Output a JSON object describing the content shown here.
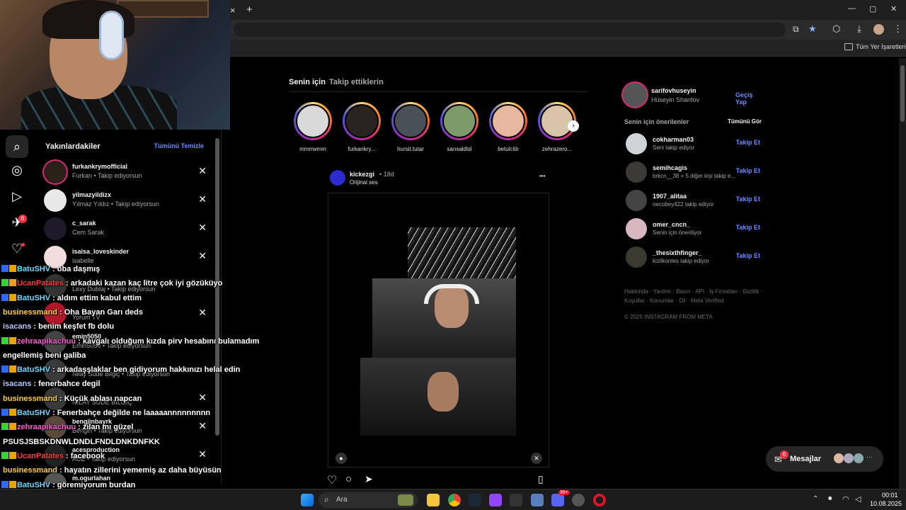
{
  "browser": {
    "new_tab": "+",
    "tab_close": "×",
    "window_controls": [
      "—",
      "▢",
      "✕"
    ],
    "bookmarks_label": "Tüm Yer İşaretleri"
  },
  "left_nav": {
    "notifications_badge": "6"
  },
  "recent_panel": {
    "title": "Yakınlardakiler",
    "clear_all": "Tümünü Temizle",
    "items": [
      {
        "username": "furkankrymofficial",
        "sub": "Furkan • Takip ediyorsun"
      },
      {
        "username": "yilmazyildizx",
        "sub": "Yılmaz Yıldız • Takip ediyorsun"
      },
      {
        "username": "c_sarak",
        "sub": "Cem Sarak"
      },
      {
        "username": "isaisa_loveskinder",
        "sub": "isabelle"
      },
      {
        "username": "",
        "sub": "Lexy Dublaj • Takip ediyorsun"
      },
      {
        "username": "",
        "sub": "Yorum TV"
      },
      {
        "username": "emin5050",
        "sub": "Emin5050 • Takip ediyorsun"
      },
      {
        "username": "",
        "sub": "Nilay Sude Bilgiç • Takip ediyorsun"
      },
      {
        "username": "",
        "sub": "NİLAY SUDE BİLGİÇ"
      },
      {
        "username": "bengiinbayrk",
        "sub": "Bengin • Takip ediyorsun"
      },
      {
        "username": "acesproduction",
        "sub": "ACE • Takip ediyorsun"
      },
      {
        "username": "m.ogurlahan",
        "sub": ""
      }
    ]
  },
  "chat": [
    {
      "name": "BatuSHV",
      "color": "#6fd8ff",
      "badge": "#2b6cff",
      "msg": ": oba daşmış"
    },
    {
      "name": "UcanPatates",
      "color": "#ff3b3b",
      "badge": "#3ad13a",
      "msg": ": arkadaki kazan kaç litre çok iyi gözüküyo"
    },
    {
      "name": "BatuSHV",
      "color": "#6fd8ff",
      "badge": "#2b6cff",
      "msg": ": aldım ettim kabul ettim"
    },
    {
      "name": "businessmand",
      "color": "#ffcc33",
      "badge": "",
      "msg": ": Oha Bayan Garı deds"
    },
    {
      "name": "isacans",
      "color": "#b6c8ff",
      "badge": "",
      "msg": ": benim keşfet fb dolu"
    },
    {
      "name": "zehraapikachuu",
      "color": "#ff5ad1",
      "badge": "#3ad13a",
      "msg": ": kavgalı olduğum kızda pirv hesabını bulamadım"
    },
    {
      "name": "",
      "color": "#fff",
      "badge": "",
      "msg": "engellemiş beni galiba"
    },
    {
      "name": "BatuSHV",
      "color": "#6fd8ff",
      "badge": "#2b6cff",
      "msg": ": arkadaşşlaklar ben gidiyorum hakkınızı helal edin"
    },
    {
      "name": "isacans",
      "color": "#b6c8ff",
      "badge": "",
      "msg": ": fenerbahce degil"
    },
    {
      "name": "businessmand",
      "color": "#ffcc33",
      "badge": "",
      "msg": ": Küçük ablası napcan"
    },
    {
      "name": "BatuSHV",
      "color": "#6fd8ff",
      "badge": "#2b6cff",
      "msg": ": Fenerbahçe değilde ne laaaaannnnnnnnn"
    },
    {
      "name": "zehraapikachuu",
      "color": "#ff5ad1",
      "badge": "#3ad13a",
      "msg": ": zilan mı güzel"
    },
    {
      "name": "",
      "color": "#fff",
      "badge": "",
      "msg": "PSUSJSBSKDNWLDNDLFNDLDNKDNFKK"
    },
    {
      "name": "UcanPatates",
      "color": "#ff3b3b",
      "badge": "#3ad13a",
      "msg": ": facebook"
    },
    {
      "name": "businessmand",
      "color": "#ffcc33",
      "badge": "",
      "msg": ": hayatın zillerini yememiş az daha büyüsün"
    },
    {
      "name": "BatuSHV",
      "color": "#6fd8ff",
      "badge": "#2b6cff",
      "msg": ": göremiyorum burdan"
    }
  ],
  "feed": {
    "tabs": [
      "Senin için",
      "Takip ettiklerin"
    ],
    "stories": [
      "mmrrwmm",
      "furkankry...",
      "hursit.tutar",
      "sansaldlsl",
      "betulcitir",
      "zehrazero..."
    ],
    "story_next": "›",
    "post": {
      "username": "kickezgi",
      "time": "• 18d",
      "audio": "Orijinal ses",
      "more": "•••"
    }
  },
  "right": {
    "me": {
      "username": "sarifovhuseyin",
      "name": "Hüseyin Sharifov",
      "switch": "Geçiş Yap"
    },
    "suggestions_title": "Senin için önerilenler",
    "see_all": "Tümünü Gör",
    "suggestions": [
      {
        "username": "cokharman03",
        "sub": "Seni takip ediyor",
        "action": "Takip Et"
      },
      {
        "username": "semihcagis",
        "sub": "brkcn__38 + 5 diğer kişi takip e...",
        "action": "Takip Et"
      },
      {
        "username": "1907_alitaa",
        "sub": "necobey422 takip ediyor",
        "action": "Takip Et"
      },
      {
        "username": "omer_cncn_",
        "sub": "Senin için öneriliyor",
        "action": "Takip Et"
      },
      {
        "username": "_thesixthfinger_",
        "sub": "kizilkontes takip ediyor",
        "action": "Takip Et"
      }
    ],
    "footer_links": "Hakkında · Yardım · Basın · API · İş Fırsatları · Gizlilik · Koşullar · Konumlar · Dil · Meta Verified",
    "copyright": "© 2025 INSTAGRAM FROM META"
  },
  "messages": {
    "label": "Mesajlar",
    "badge": "6",
    "more": "···"
  },
  "taskbar": {
    "search": "Ara",
    "time": "00:01",
    "date": "10.08.2025",
    "steam_badge": "1",
    "discord_badge": "99+"
  }
}
